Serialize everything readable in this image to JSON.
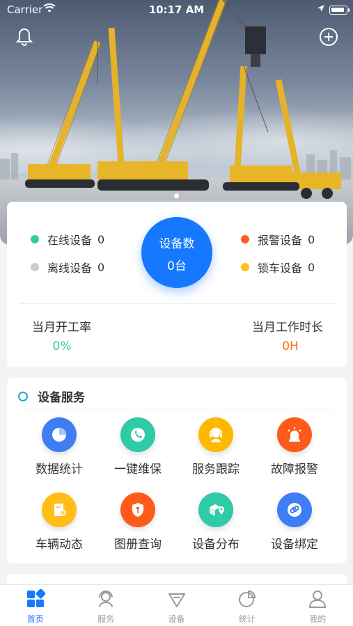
{
  "status_bar": {
    "carrier": "Carrier",
    "time": "10:17 AM"
  },
  "colors": {
    "primary": "#1677ff",
    "online": "#34c8a6",
    "offline": "#cccccc",
    "alarm": "#ff5a1f",
    "locked": "#ffbf1a",
    "rate_value": "#34c8a6",
    "hours_value": "#ff6a1a"
  },
  "stats": {
    "online_label": "在线设备",
    "online_count": "0",
    "offline_label": "离线设备",
    "offline_count": "0",
    "alarm_label": "报警设备",
    "alarm_count": "0",
    "locked_label": "锁车设备",
    "locked_count": "0",
    "device_count_title": "设备数",
    "device_count_value": "0台",
    "month_rate_label": "当月开工率",
    "month_rate_value": "0%",
    "month_hours_label": "当月工作时长",
    "month_hours_value": "0H"
  },
  "services": {
    "title": "设备服务",
    "items": [
      {
        "label": "数据统计",
        "icon": "pie-chart-icon",
        "color": "#3f7df5"
      },
      {
        "label": "一键维保",
        "icon": "phone-icon",
        "color": "#2fcaa6"
      },
      {
        "label": "服务跟踪",
        "icon": "headset-icon",
        "color": "#ffb800"
      },
      {
        "label": "故障报警",
        "icon": "alarm-light-icon",
        "color": "#ff5a1a"
      },
      {
        "label": "车辆动态",
        "icon": "vehicle-doc-icon",
        "color": "#ffbd16"
      },
      {
        "label": "图册查询",
        "icon": "shield-wrench-icon",
        "color": "#ff5a1a"
      },
      {
        "label": "设备分布",
        "icon": "map-cube-icon",
        "color": "#2fcaa6"
      },
      {
        "label": "设备绑定",
        "icon": "link-icon",
        "color": "#3f7df5"
      }
    ]
  },
  "tabs": [
    {
      "label": "首页",
      "icon": "home-grid-icon",
      "active": true
    },
    {
      "label": "服务",
      "icon": "service-person-icon",
      "active": false
    },
    {
      "label": "设备",
      "icon": "device-icon",
      "active": false
    },
    {
      "label": "统计",
      "icon": "pie-chart-icon",
      "active": false
    },
    {
      "label": "我的",
      "icon": "user-icon",
      "active": false
    }
  ]
}
